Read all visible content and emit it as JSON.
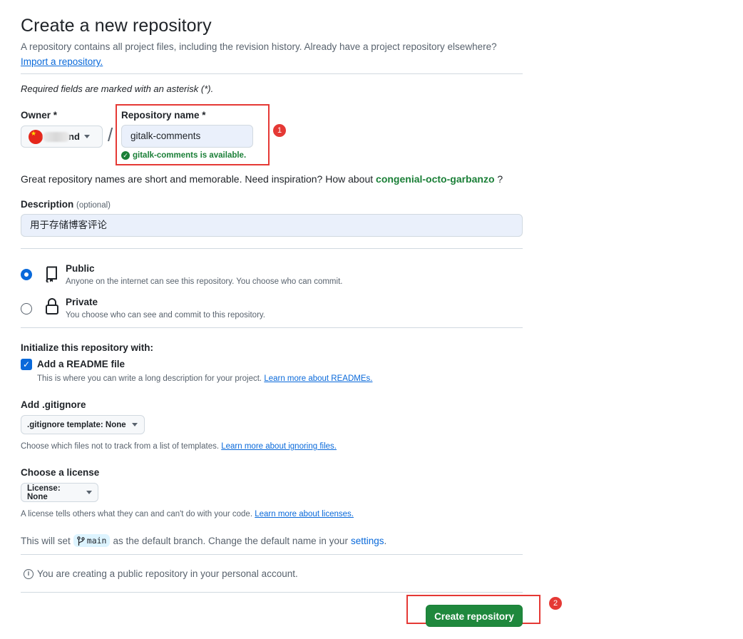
{
  "header": {
    "title": "Create a new repository",
    "subtitle": "A repository contains all project files, including the revision history. Already have a project repository elsewhere?",
    "import_link": "Import a repository."
  },
  "required_note": "Required fields are marked with an asterisk (*).",
  "owner": {
    "label": "Owner *",
    "value": "nd"
  },
  "slash": "/",
  "repo_name": {
    "label": "Repository name *",
    "value": "gitalk-comments",
    "availability": "gitalk-comments is available."
  },
  "annotations": {
    "badge1": "1",
    "badge2": "2",
    "color": "#e53935"
  },
  "name_hint": {
    "prefix": "Great repository names are short and memorable. Need inspiration? How about",
    "suggestion": "congenial-octo-garbanzo",
    "suffix": "?"
  },
  "description": {
    "label": "Description",
    "optional": "(optional)",
    "value": "用于存储博客评论"
  },
  "visibility": {
    "options": [
      {
        "title": "Public",
        "desc": "Anyone on the internet can see this repository. You choose who can commit.",
        "selected": true,
        "icon": "repo-icon"
      },
      {
        "title": "Private",
        "desc": "You choose who can see and commit to this repository.",
        "selected": false,
        "icon": "lock-icon"
      }
    ]
  },
  "init": {
    "title": "Initialize this repository with:",
    "readme_label": "Add a README file",
    "readme_checked": true,
    "readme_desc": "This is where you can write a long description for your project.",
    "readme_link": "Learn more about READMEs."
  },
  "gitignore": {
    "title": "Add .gitignore",
    "select_prefix": ".gitignore template:",
    "select_value": "None",
    "desc": "Choose which files not to track from a list of templates.",
    "link": "Learn more about ignoring files."
  },
  "license": {
    "title": "Choose a license",
    "select_prefix": "License:",
    "select_value": "None",
    "desc": "A license tells others what they can and can't do with your code.",
    "link": "Learn more about licenses."
  },
  "branch": {
    "prefix": "This will set",
    "name": "main",
    "middle": "as the default branch. Change the default name in your",
    "link": "settings",
    "suffix": "."
  },
  "info": "You are creating a public repository in your personal account.",
  "create_button": "Create repository",
  "colors": {
    "primary_button": "#1f883d",
    "link": "#0969da",
    "success": "#1a7f37"
  }
}
